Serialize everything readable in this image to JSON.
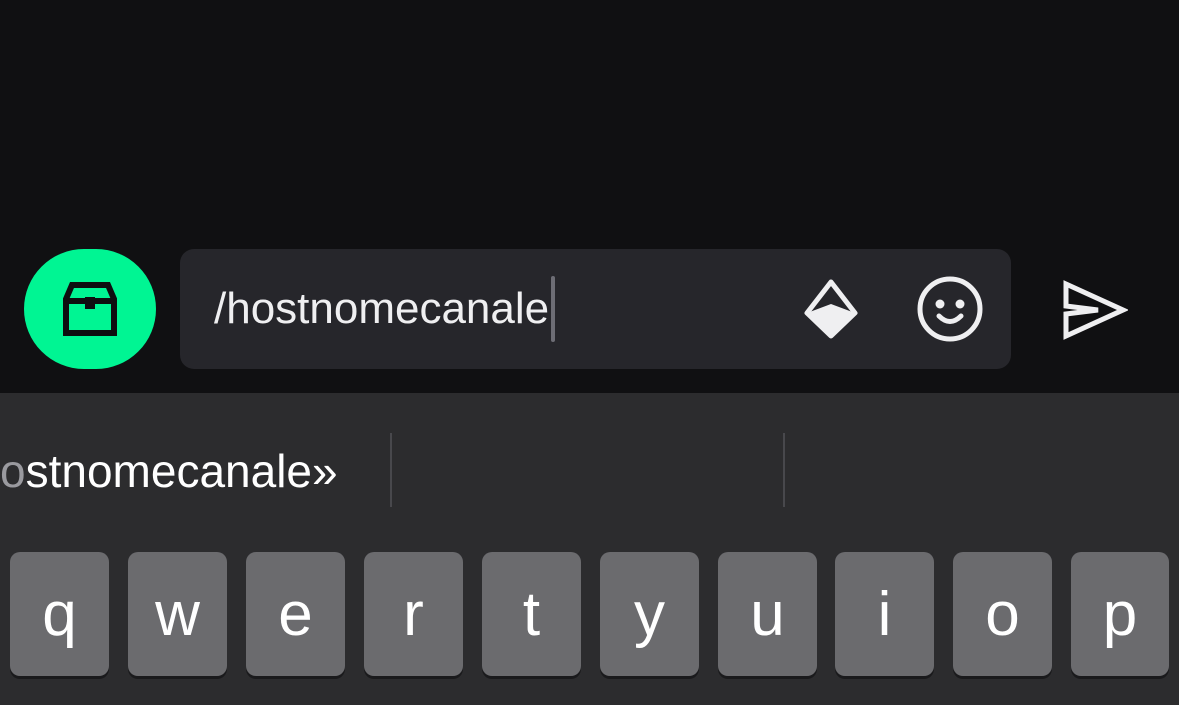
{
  "composer": {
    "chest_button_icon": "treasure-chest-icon",
    "input_value": "/hostnomecanale",
    "bits_icon": "bits-diamond-icon",
    "emote_icon": "smiley-face-icon",
    "send_icon": "send-arrow-icon"
  },
  "keyboard": {
    "suggestions": [
      {
        "prefix": "o",
        "main": "stnomecanale»"
      },
      {
        "prefix": "",
        "main": ""
      },
      {
        "prefix": "",
        "main": ""
      }
    ],
    "row1": [
      "q",
      "w",
      "e",
      "r",
      "t",
      "y",
      "u",
      "i",
      "o",
      "p"
    ]
  },
  "colors": {
    "background": "#101012",
    "accent": "#00F593",
    "input_bg": "#26262b",
    "keyboard_bg": "#2c2c2e",
    "key_bg": "#6b6b6e"
  }
}
